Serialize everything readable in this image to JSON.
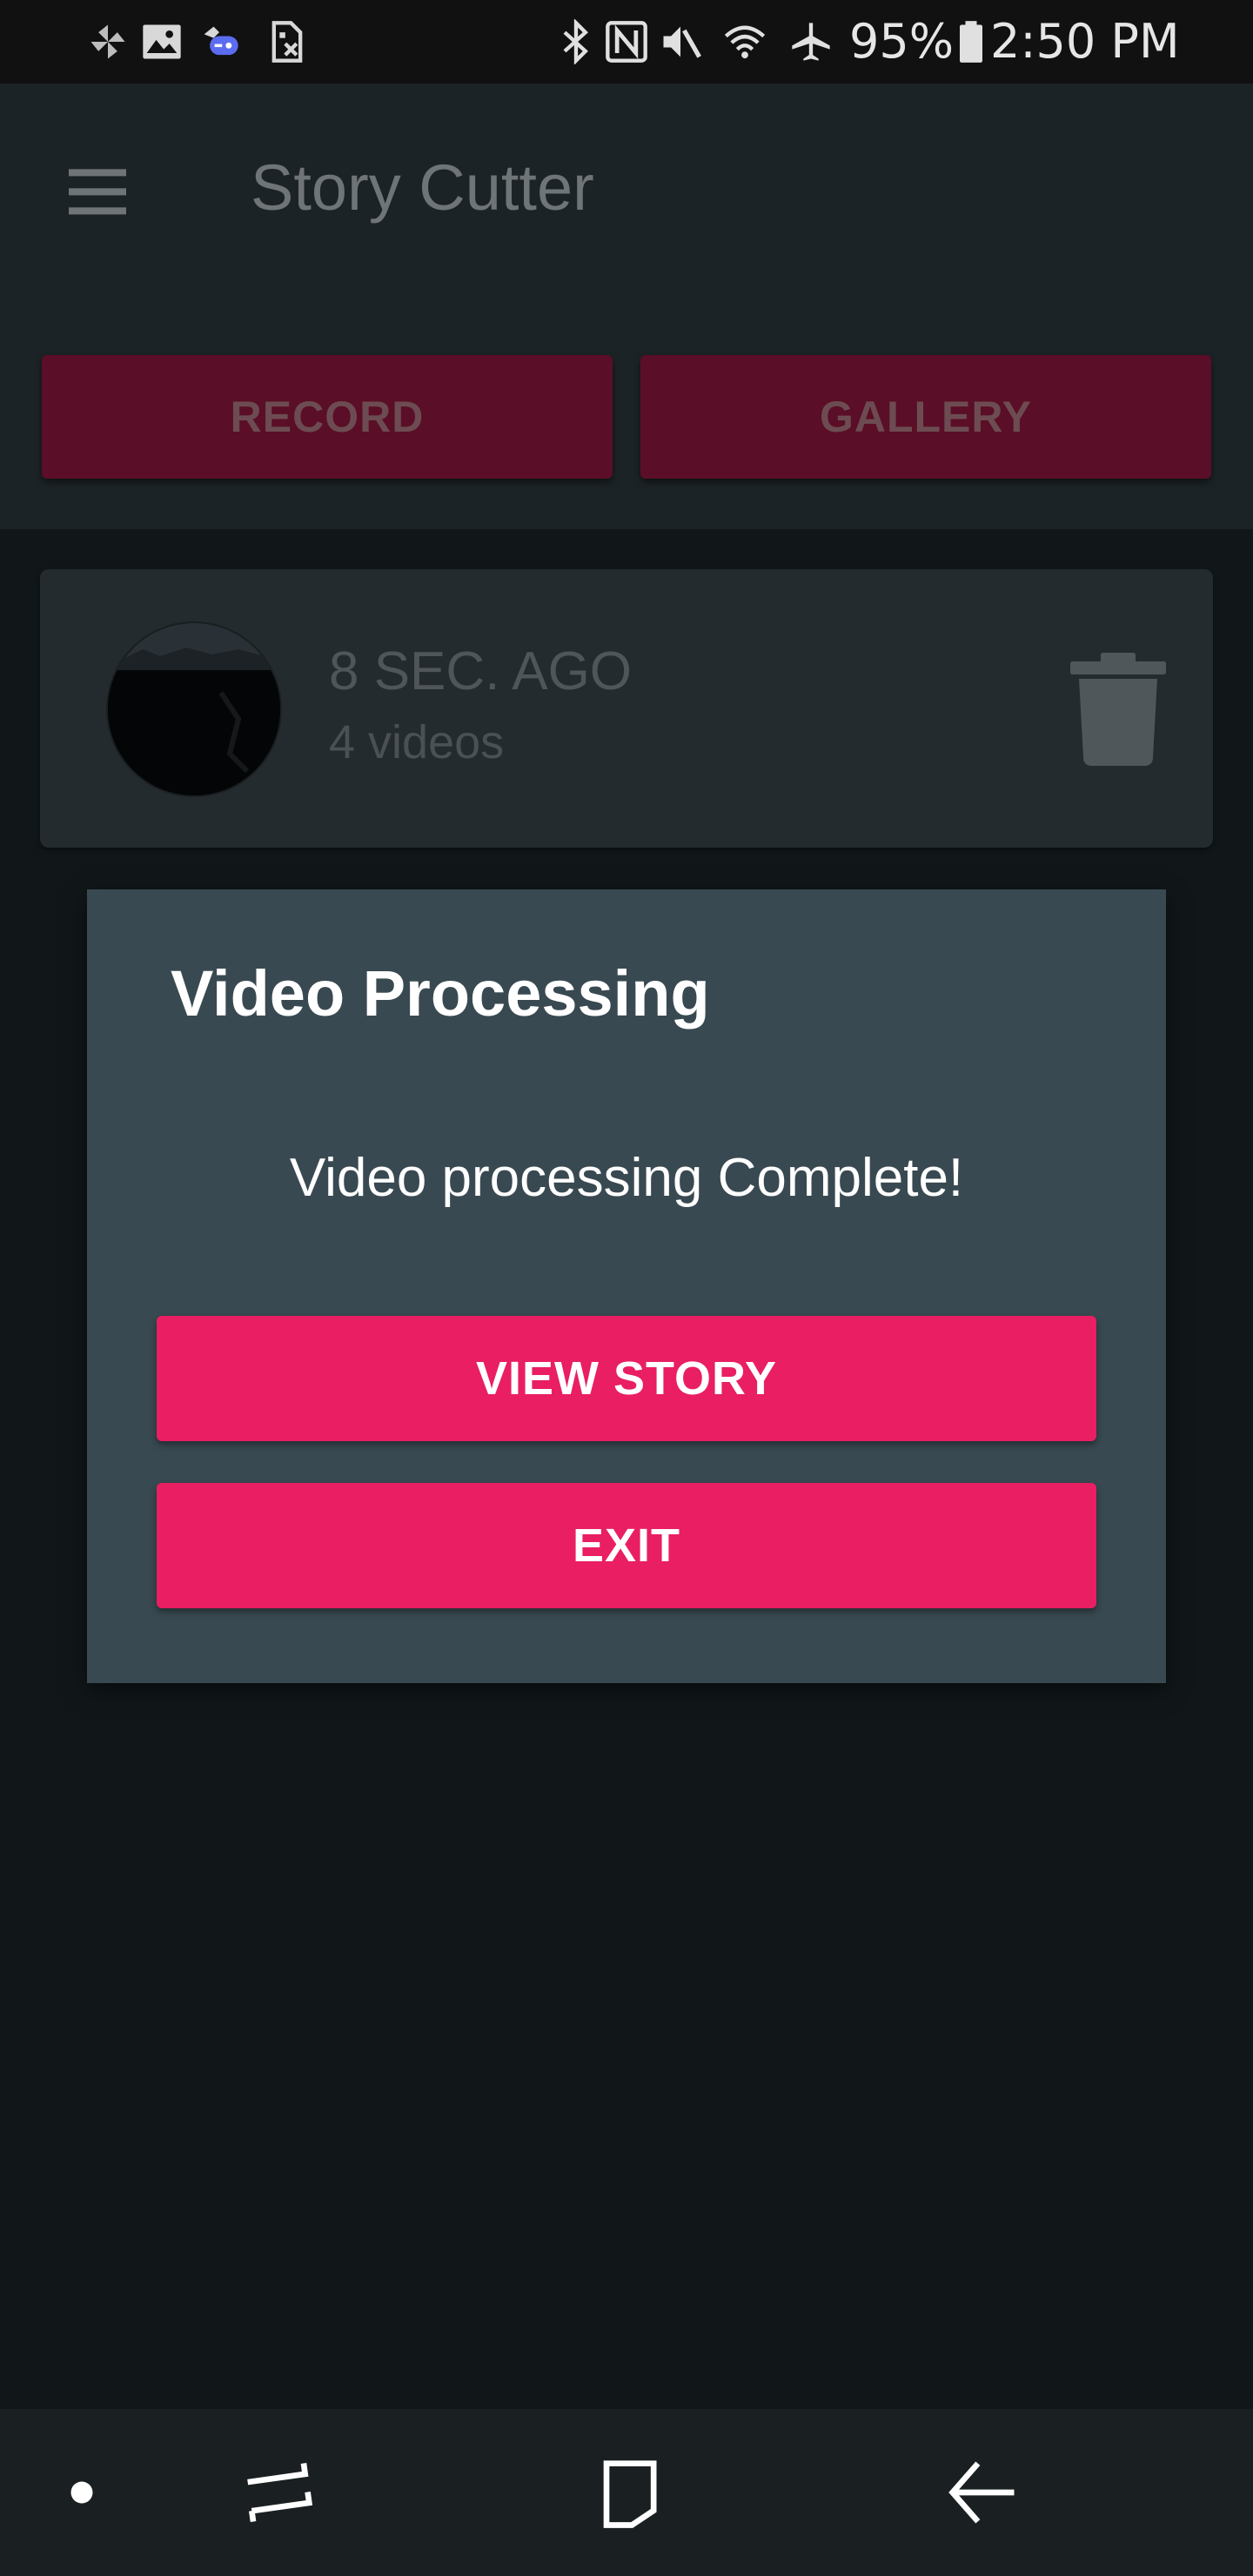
{
  "status_bar": {
    "icons": [
      "pinwheel-icon",
      "image-icon",
      "game-controller-icon",
      "sim-off-icon",
      "bluetooth-icon",
      "nfc-icon",
      "mute-icon",
      "wifi-icon",
      "airplane-mode-icon",
      "battery-icon"
    ],
    "battery_percent": "95%",
    "time": "2:50 PM"
  },
  "app_bar": {
    "title": "Story Cutter",
    "menu_icon": "menu-icon",
    "record_label": "RECORD",
    "gallery_label": "GALLERY"
  },
  "story": {
    "time_ago": "8 SEC. AGO",
    "video_count": "4 videos",
    "delete_icon": "trash-icon"
  },
  "dialog": {
    "title": "Video Processing",
    "message": "Video processing Complete!",
    "view_story_label": "VIEW STORY",
    "exit_label": "EXIT"
  },
  "nav_bar": {
    "icons": [
      "dot-icon",
      "recent-apps-icon",
      "home-icon",
      "back-icon"
    ]
  },
  "colors": {
    "accent": "#e91e63",
    "accent_dimmed": "#5b0e27",
    "dialog_bg": "#394951",
    "screen_bg": "#111719",
    "status_bar_bg": "#111111"
  }
}
